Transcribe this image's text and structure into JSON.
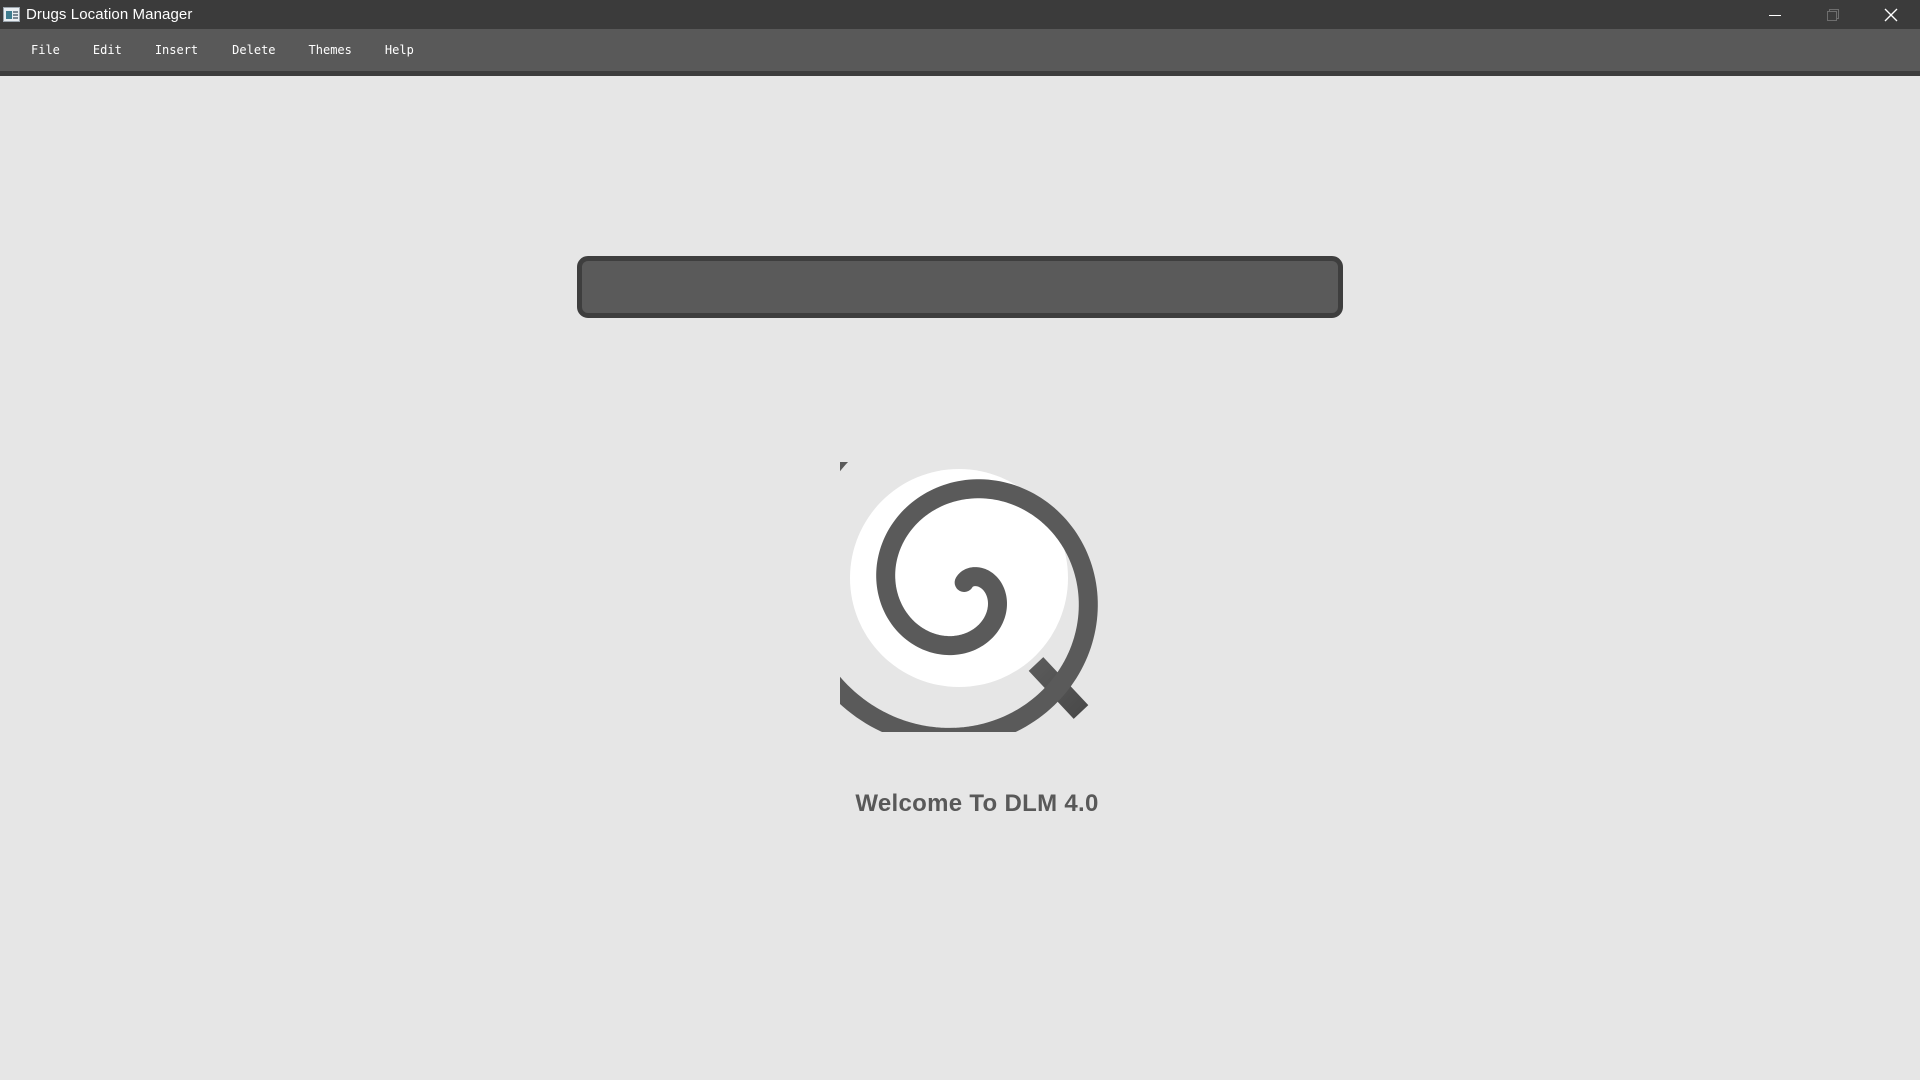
{
  "window": {
    "title": "Drugs Location Manager",
    "controls": {
      "minimize": "minimize-icon",
      "maximize": "maximize-icon",
      "close": "close-icon"
    }
  },
  "menubar": {
    "items": [
      {
        "label": "File"
      },
      {
        "label": "Edit"
      },
      {
        "label": "Insert"
      },
      {
        "label": "Delete"
      },
      {
        "label": "Themes"
      },
      {
        "label": "Help"
      }
    ]
  },
  "search": {
    "value": "",
    "placeholder": ""
  },
  "logo": {
    "icon": "spiral-magnifier-icon"
  },
  "welcome": {
    "text": "Welcome To DLM 4.0"
  },
  "colors": {
    "titlebar": "#3b3b3b",
    "menubar": "#595959",
    "background": "#e6e6e6",
    "accent": "#595959",
    "search_bg": "#5a5a5a",
    "search_border": "#3e3e3e"
  }
}
